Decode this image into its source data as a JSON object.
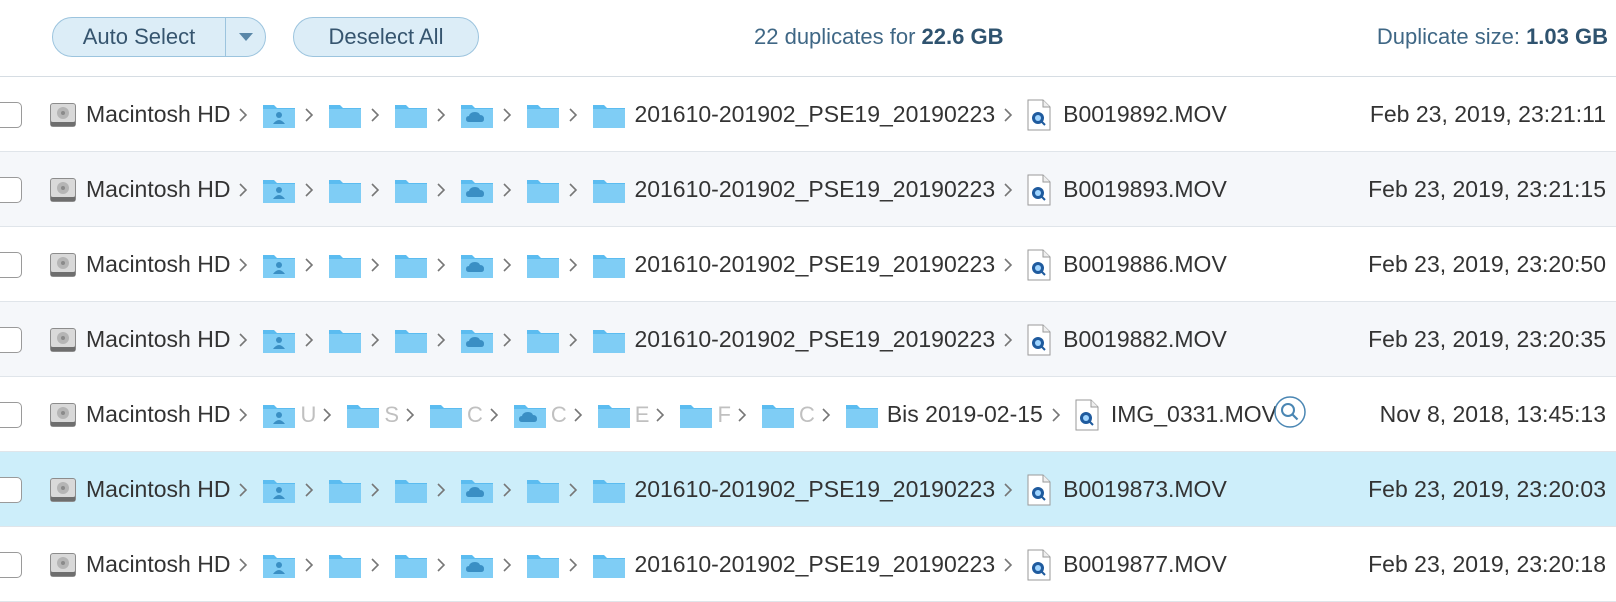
{
  "toolbar": {
    "auto_select_label": "Auto Select",
    "deselect_label": "Deselect All",
    "summary_prefix": "22 duplicates for ",
    "summary_size": "22.6 GB",
    "dup_size_prefix": "Duplicate size: ",
    "dup_size_value": "1.03 GB"
  },
  "colors": {
    "accent": "#36556f",
    "selected_row": "#cdeefa",
    "folder": "#5bbcf0"
  },
  "icons": [
    "hard-drive-icon",
    "user-folder-icon",
    "folder-icon",
    "cloud-folder-icon",
    "movie-file-icon",
    "chevron-right-icon",
    "magnifier-icon"
  ],
  "rows": [
    {
      "volume": "Macintosh HD",
      "folder": "201610-201902_PSE19_20190223",
      "file": "B0019892.MOV",
      "date": "Feb 23, 2019, 23:21:11"
    },
    {
      "volume": "Macintosh HD",
      "folder": "201610-201902_PSE19_20190223",
      "file": "B0019893.MOV",
      "date": "Feb 23, 2019, 23:21:15"
    },
    {
      "volume": "Macintosh HD",
      "folder": "201610-201902_PSE19_20190223",
      "file": "B0019886.MOV",
      "date": "Feb 23, 2019, 23:20:50"
    },
    {
      "volume": "Macintosh HD",
      "folder": "201610-201902_PSE19_20190223",
      "file": "B0019882.MOV",
      "date": "Feb 23, 2019, 23:20:35"
    },
    {
      "volume": "Macintosh HD",
      "folder": "Bis 2019-02-15",
      "file": "IMG_0331.MOV",
      "date": "Nov 8, 2018, 13:45:13",
      "truncated": [
        "U",
        "S",
        "C",
        "C",
        "E",
        "F",
        "C"
      ]
    },
    {
      "volume": "Macintosh HD",
      "folder": "201610-201902_PSE19_20190223",
      "file": "B0019873.MOV",
      "date": "Feb 23, 2019, 23:20:03",
      "selected": true
    },
    {
      "volume": "Macintosh HD",
      "folder": "201610-201902_PSE19_20190223",
      "file": "B0019877.MOV",
      "date": "Feb 23, 2019, 23:20:18"
    }
  ]
}
